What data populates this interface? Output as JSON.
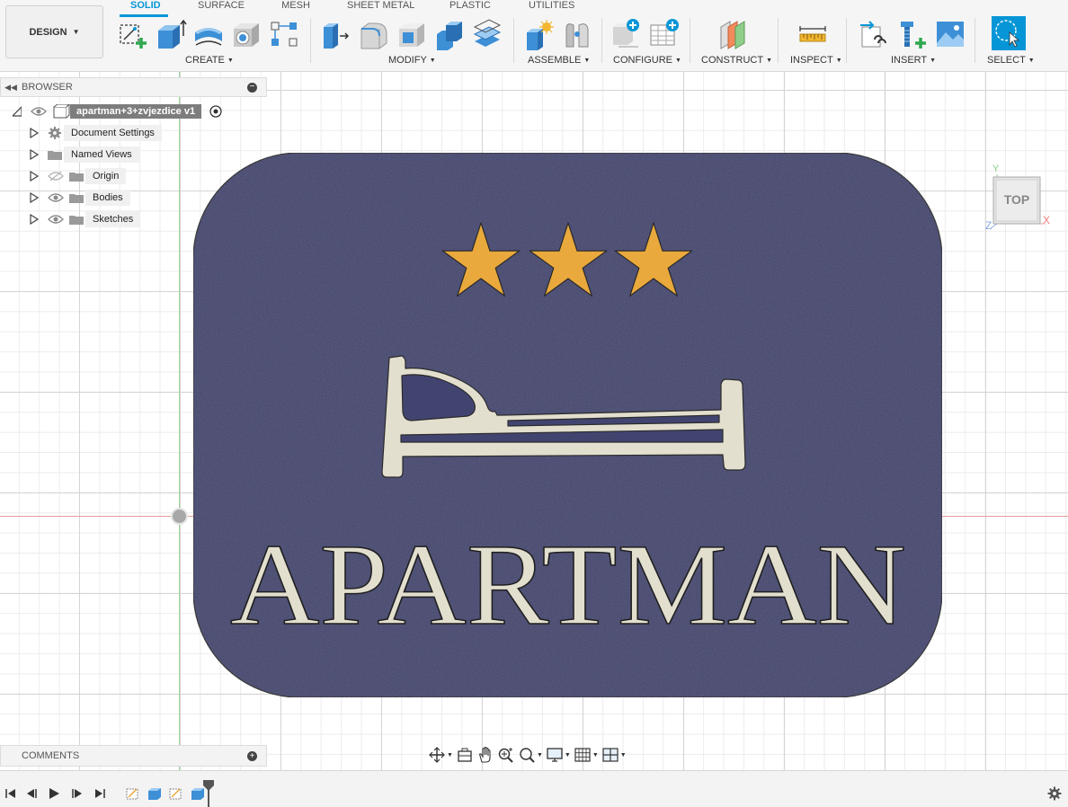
{
  "workspace": {
    "label": "DESIGN"
  },
  "tabs": [
    {
      "label": "SOLID",
      "active": true
    },
    {
      "label": "SURFACE",
      "active": false
    },
    {
      "label": "MESH",
      "active": false
    },
    {
      "label": "SHEET METAL",
      "active": false
    },
    {
      "label": "PLASTIC",
      "active": false
    },
    {
      "label": "UTILITIES",
      "active": false
    }
  ],
  "groups": {
    "create": "CREATE",
    "modify": "MODIFY",
    "assemble": "ASSEMBLE",
    "configure": "CONFIGURE",
    "construct": "CONSTRUCT",
    "inspect": "INSPECT",
    "insert": "INSERT",
    "select": "SELECT"
  },
  "browser": {
    "title": "BROWSER",
    "root": "apartman+3+zvjezdice v1",
    "nodes": [
      {
        "label": "Document Settings",
        "icon": "gear-icon"
      },
      {
        "label": "Named Views",
        "icon": "folder-icon"
      },
      {
        "label": "Origin",
        "icon": "folder-icon",
        "hidden": true
      },
      {
        "label": "Bodies",
        "icon": "folder-icon"
      },
      {
        "label": "Sketches",
        "icon": "folder-icon"
      }
    ]
  },
  "viewcube": {
    "face": "TOP",
    "x": "X",
    "y": "Y",
    "z": "Z"
  },
  "comments": {
    "title": "COMMENTS"
  },
  "model": {
    "text": "APARTMAN",
    "stars": 3,
    "plate_color": "#424470",
    "star_color": "#e9a93c",
    "relief_color": "#e3dfcf"
  },
  "colors": {
    "accent": "#0696d7",
    "axis_x": "#e89a9a",
    "axis_y": "#9cd49c"
  }
}
